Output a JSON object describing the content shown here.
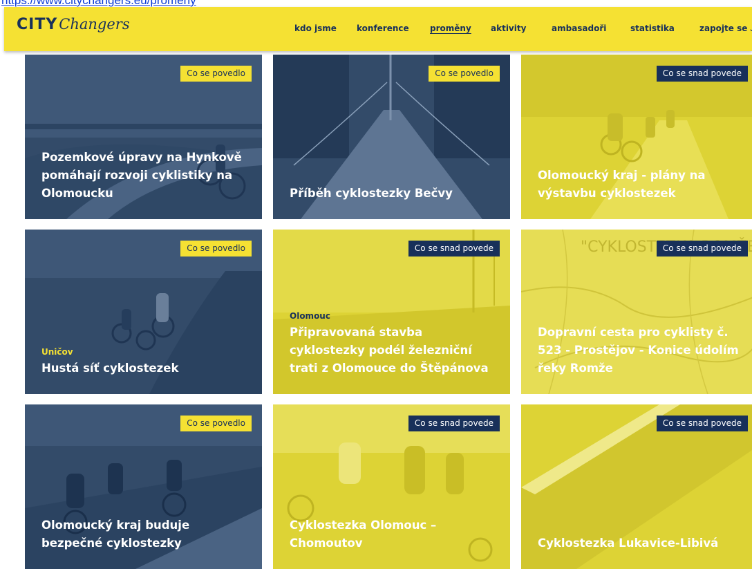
{
  "url": "https://www.citychangers.eu/promeny",
  "logo": {
    "city": "CITY",
    "changers": "Changers"
  },
  "nav": [
    {
      "label": "kdo jsme"
    },
    {
      "label": "konference"
    },
    {
      "label": "proměny",
      "active": true
    },
    {
      "label": "aktivity"
    },
    {
      "label": "ambasadoři"
    },
    {
      "label": "statistika"
    },
    {
      "label": "zapojte se"
    }
  ],
  "colors": {
    "brand_yellow": "#f5e133",
    "brand_navy": "#18305a",
    "card_blue": "#334b69",
    "card_yellow": "#ddd335"
  },
  "cards": [
    {
      "badge": "Co se povedlo",
      "place": "",
      "title": "Pozemkové úpravy na Hynkově pomáhají rozvoji cyklistiky na Olomoucku"
    },
    {
      "badge": "Co se povedlo",
      "place": "",
      "title": "Příběh cyklostezky Bečvy"
    },
    {
      "badge": "Co se snad povede",
      "place": "",
      "title": "Olomoucký kraj - plány na výstavbu cyklostezek"
    },
    {
      "badge": "Co se povedlo",
      "place": "Uničov",
      "title": "Hustá síť cyklostezek"
    },
    {
      "badge": "Co se snad povede",
      "place": "Olomouc",
      "title": "Připravovaná stavba cyklostezky podél železniční trati z Olomouce do Štěpánova"
    },
    {
      "badge": "Co se snad povede",
      "place": "",
      "title": "Dopravní cesta pro cyklisty č. 523 - Prostějov - Konice údolím řeky Romže"
    },
    {
      "badge": "Co se povedlo",
      "place": "",
      "title": "Olomoucký kraj buduje bezpečné cyklostezky"
    },
    {
      "badge": "Co se snad povede",
      "place": "",
      "title": "Cyklostezka Olomouc – Chomoutov"
    },
    {
      "badge": "Co se snad povede",
      "place": "",
      "title": "Cyklostezka Lukavice-Libivá"
    }
  ]
}
